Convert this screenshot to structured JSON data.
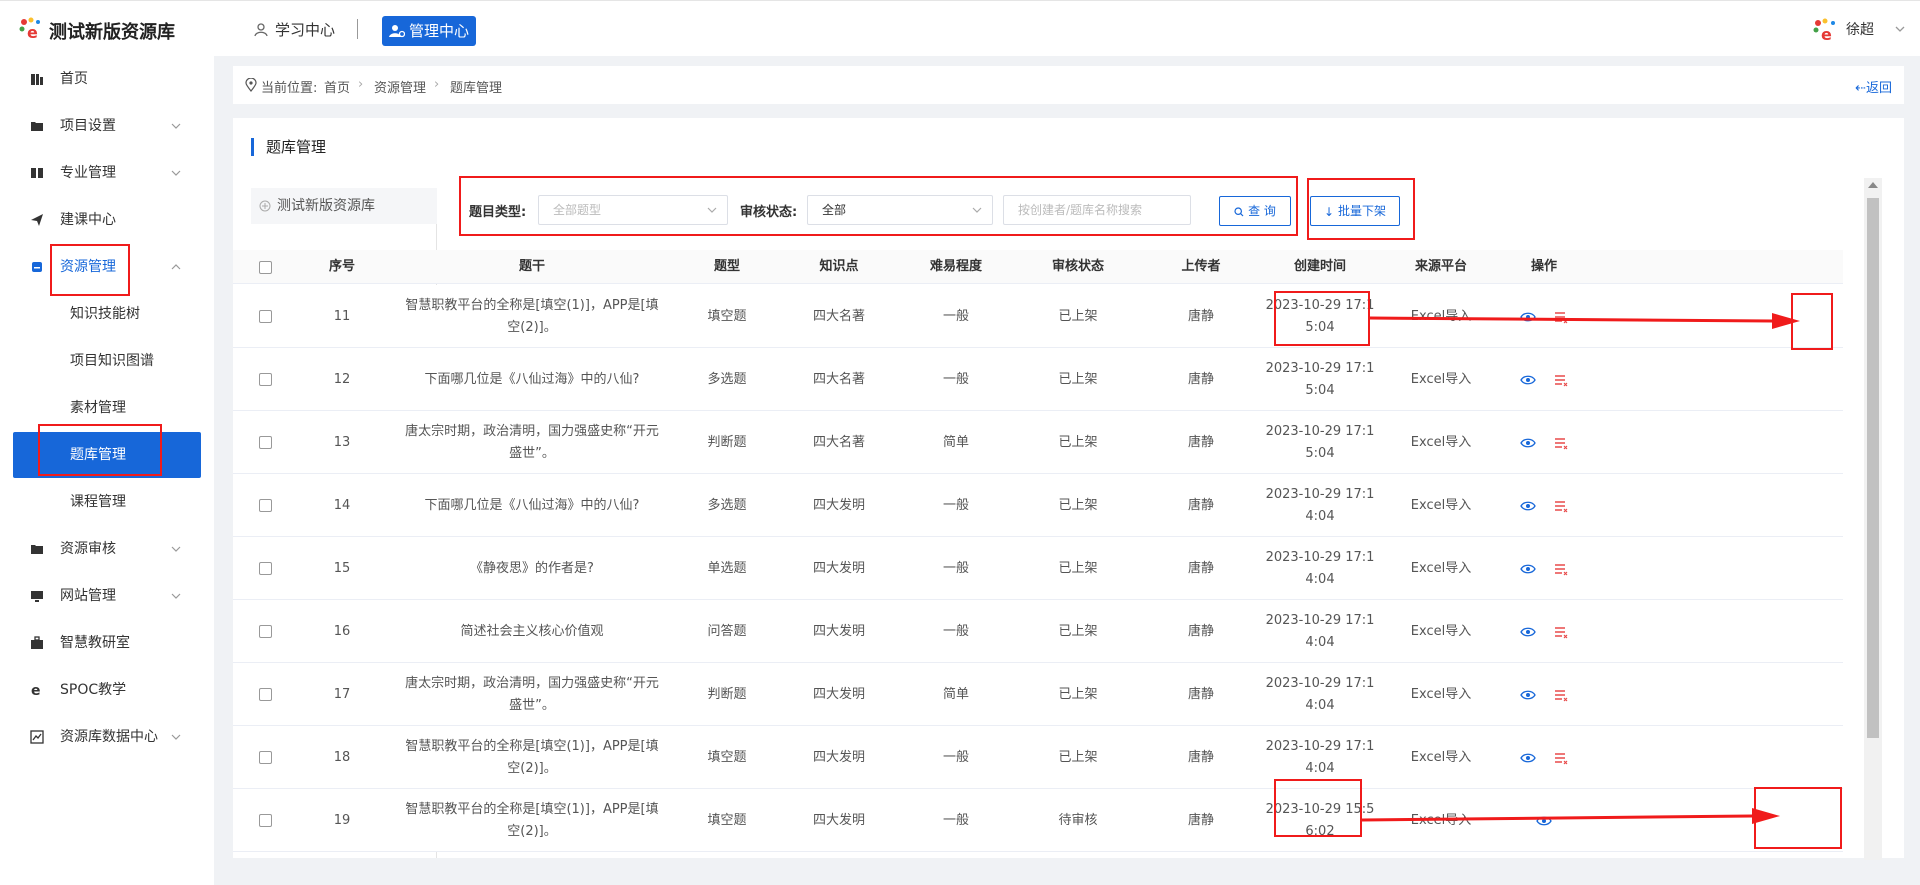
{
  "app": {
    "title": "测试新版资源库",
    "nav_learning": "学习中心",
    "nav_admin": "管理中心",
    "user_name": "徐超"
  },
  "sidebar": {
    "items": [
      {
        "label": "首页",
        "icon": "home-icon"
      },
      {
        "label": "项目设置",
        "icon": "folder-icon"
      },
      {
        "label": "专业管理",
        "icon": "book-icon"
      },
      {
        "label": "建课中心",
        "icon": "send-icon"
      },
      {
        "label": "资源管理",
        "icon": "database-icon"
      },
      {
        "label": "资源审核",
        "icon": "inbox-icon"
      },
      {
        "label": "网站管理",
        "icon": "monitor-icon"
      },
      {
        "label": "智慧教研室",
        "icon": "briefcase-icon"
      },
      {
        "label": "SPOC教学",
        "icon": "e-icon"
      },
      {
        "label": "资源库数据中心",
        "icon": "chart-icon"
      }
    ],
    "sub_items": [
      "知识技能树",
      "项目知识图谱",
      "素材管理",
      "题库管理",
      "课程管理"
    ]
  },
  "breadcrumb": {
    "prefix": "当前位置:",
    "items": [
      "首页",
      "资源管理",
      "题库管理"
    ],
    "back": "返回"
  },
  "panel": {
    "title": "题库管理",
    "tree_item": "测试新版资源库"
  },
  "filter": {
    "type_label": "题目类型:",
    "type_placeholder": "全部题型",
    "status_label": "审核状态:",
    "status_value": "全部",
    "search_placeholder": "按创建者/题库名称搜索",
    "search_button": "查 询",
    "batch_button": "批量下架"
  },
  "table": {
    "columns": [
      "序号",
      "题干",
      "题型",
      "知识点",
      "难易程度",
      "审核状态",
      "上传者",
      "创建时间",
      "来源平台",
      "操作"
    ],
    "rows": [
      {
        "no": "11",
        "stem": "智慧职教平台的全称是[填空(1)]，APP是[填空(2)]。",
        "type": "填空题",
        "kp": "四大名著",
        "level": "一般",
        "status": "已上架",
        "uploader": "唐静",
        "time": "2023-10-29 17:15:04",
        "source": "Excel导入"
      },
      {
        "no": "12",
        "stem": "下面哪几位是《八仙过海》中的八仙?",
        "type": "多选题",
        "kp": "四大名著",
        "level": "一般",
        "status": "已上架",
        "uploader": "唐静",
        "time": "2023-10-29 17:15:04",
        "source": "Excel导入"
      },
      {
        "no": "13",
        "stem": "唐太宗时期，政治清明，国力强盛史称“开元盛世”。",
        "type": "判断题",
        "kp": "四大名著",
        "level": "简单",
        "status": "已上架",
        "uploader": "唐静",
        "time": "2023-10-29 17:15:04",
        "source": "Excel导入"
      },
      {
        "no": "14",
        "stem": "下面哪几位是《八仙过海》中的八仙?",
        "type": "多选题",
        "kp": "四大发明",
        "level": "一般",
        "status": "已上架",
        "uploader": "唐静",
        "time": "2023-10-29 17:14:04",
        "source": "Excel导入"
      },
      {
        "no": "15",
        "stem": "《静夜思》的作者是?",
        "type": "单选题",
        "kp": "四大发明",
        "level": "一般",
        "status": "已上架",
        "uploader": "唐静",
        "time": "2023-10-29 17:14:04",
        "source": "Excel导入"
      },
      {
        "no": "16",
        "stem": "简述社会主义核心价值观",
        "type": "问答题",
        "kp": "四大发明",
        "level": "一般",
        "status": "已上架",
        "uploader": "唐静",
        "time": "2023-10-29 17:14:04",
        "source": "Excel导入"
      },
      {
        "no": "17",
        "stem": "唐太宗时期，政治清明，国力强盛史称“开元盛世”。",
        "type": "判断题",
        "kp": "四大发明",
        "level": "简单",
        "status": "已上架",
        "uploader": "唐静",
        "time": "2023-10-29 17:14:04",
        "source": "Excel导入"
      },
      {
        "no": "18",
        "stem": "智慧职教平台的全称是[填空(1)]，APP是[填空(2)]。",
        "type": "填空题",
        "kp": "四大发明",
        "level": "一般",
        "status": "已上架",
        "uploader": "唐静",
        "time": "2023-10-29 17:14:04",
        "source": "Excel导入"
      },
      {
        "no": "19",
        "stem": "智慧职教平台的全称是[填空(1)]，APP是[填空(2)]。",
        "type": "填空题",
        "kp": "四大发明",
        "level": "一般",
        "status": "待审核",
        "uploader": "唐静",
        "time": "2023-10-29 15:56:02",
        "source": "Excel导入"
      }
    ]
  },
  "colors": {
    "accent": "#1767d9",
    "annotation": "#f01b1b",
    "delete": "#e84a4a"
  }
}
